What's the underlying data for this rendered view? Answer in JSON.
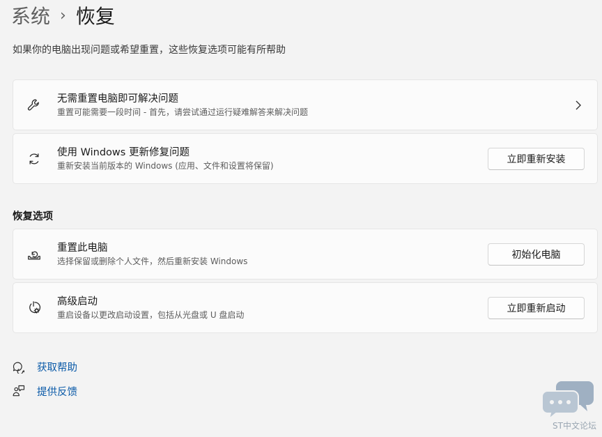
{
  "breadcrumb": {
    "parent": "系统",
    "separator": "›",
    "current": "恢复"
  },
  "description": "如果你的电脑出现问题或希望重置，这些恢复选项可能有所帮助",
  "cards": [
    {
      "title": "无需重置电脑即可解决问题",
      "subtitle": "重置可能需要一段时间 - 首先，请尝试通过运行疑难解答来解决问题",
      "icon": "wrench-icon"
    },
    {
      "title": "使用 Windows 更新修复问题",
      "subtitle": "重新安装当前版本的 Windows (应用、文件和设置将保留)",
      "icon": "refresh-icon",
      "button": "立即重新安装"
    }
  ],
  "recovery": {
    "section_title": "恢复选项",
    "items": [
      {
        "title": "重置此电脑",
        "subtitle": "选择保留或删除个人文件，然后重新安装 Windows",
        "icon": "reset-pc-icon",
        "button": "初始化电脑"
      },
      {
        "title": "高级启动",
        "subtitle": "重启设备以更改启动设置，包括从光盘或 U 盘启动",
        "icon": "advanced-startup-icon",
        "button": "立即重新启动"
      }
    ]
  },
  "links": [
    {
      "label": "获取帮助",
      "icon": "help-chat-icon"
    },
    {
      "label": "提供反馈",
      "icon": "feedback-icon"
    }
  ],
  "watermark": {
    "text": "ST中文论坛",
    "icon": "chat-bubbles-icon"
  },
  "colors": {
    "link": "#0a5aa8",
    "background": "#f3f3f3",
    "card": "#fbfbfb"
  }
}
